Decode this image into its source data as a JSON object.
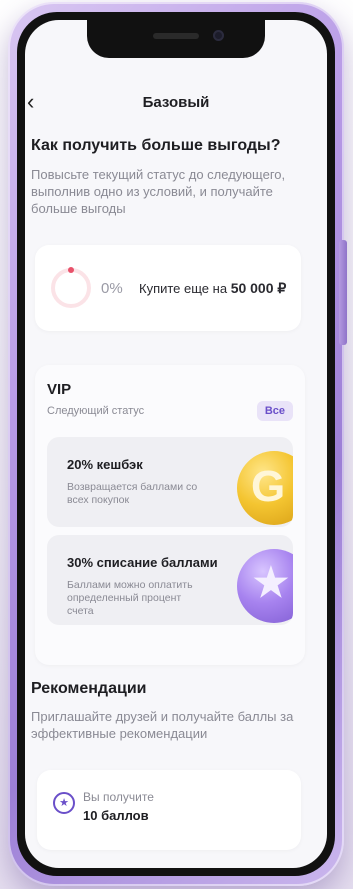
{
  "header": {
    "title": "Базовый",
    "back_icon": "chevron-left-icon"
  },
  "benefits_intro": {
    "heading": "Как получить больше выгоды?",
    "description": "Повысьте текущий статус до следующего, выполнив одно из условий, и получайте больше выгоды"
  },
  "progress": {
    "percent_label": "0%",
    "percent_value": 0,
    "buy_prefix": "Купите еще на",
    "buy_amount": "50 000 ₽",
    "accent_color": "#e8516a"
  },
  "next_status": {
    "name": "VIP",
    "subtitle": "Следующий статус",
    "all_button": "Все",
    "items": [
      {
        "title": "20% кешбэк",
        "description": "Возвращается баллами со всех покупок",
        "icon": "gold-coin-icon"
      },
      {
        "title": "30% списание баллами",
        "description": "Баллами можно оплатить определенный процент счета",
        "icon": "purple-star-coin-icon"
      }
    ]
  },
  "recommendations": {
    "title": "Рекомендации",
    "description": "Приглашайте друзей и получайте баллы за эффективные рекомендации",
    "reward_label": "Вы получите",
    "reward_value": "10 баллов",
    "reward_icon": "star-circle-icon"
  },
  "colors": {
    "accent": "#6a4fc9",
    "phone_frame": "#b79ae6"
  }
}
